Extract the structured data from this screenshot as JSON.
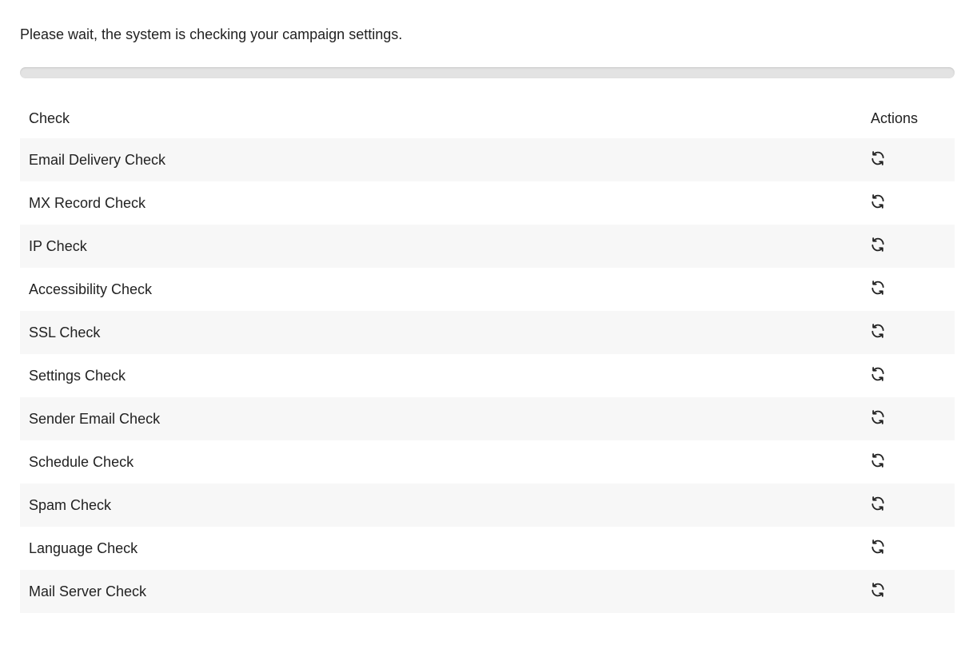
{
  "status": {
    "message": "Please wait, the system is checking your campaign settings."
  },
  "progress": {
    "percent": 0
  },
  "table": {
    "headers": {
      "check": "Check",
      "actions": "Actions"
    },
    "rows": [
      {
        "check": "Email Delivery Check",
        "action_icon": "refresh-icon"
      },
      {
        "check": "MX Record Check",
        "action_icon": "refresh-icon"
      },
      {
        "check": "IP Check",
        "action_icon": "refresh-icon"
      },
      {
        "check": "Accessibility Check",
        "action_icon": "refresh-icon"
      },
      {
        "check": "SSL Check",
        "action_icon": "refresh-icon"
      },
      {
        "check": "Settings Check",
        "action_icon": "refresh-icon"
      },
      {
        "check": "Sender Email Check",
        "action_icon": "refresh-icon"
      },
      {
        "check": "Schedule Check",
        "action_icon": "refresh-icon"
      },
      {
        "check": "Spam Check",
        "action_icon": "refresh-icon"
      },
      {
        "check": "Language Check",
        "action_icon": "refresh-icon"
      },
      {
        "check": "Mail Server Check",
        "action_icon": "refresh-icon"
      }
    ]
  },
  "colors": {
    "row_stripe": "#f7f7f7",
    "progress_track": "#e3e3e3",
    "text": "#222222"
  }
}
